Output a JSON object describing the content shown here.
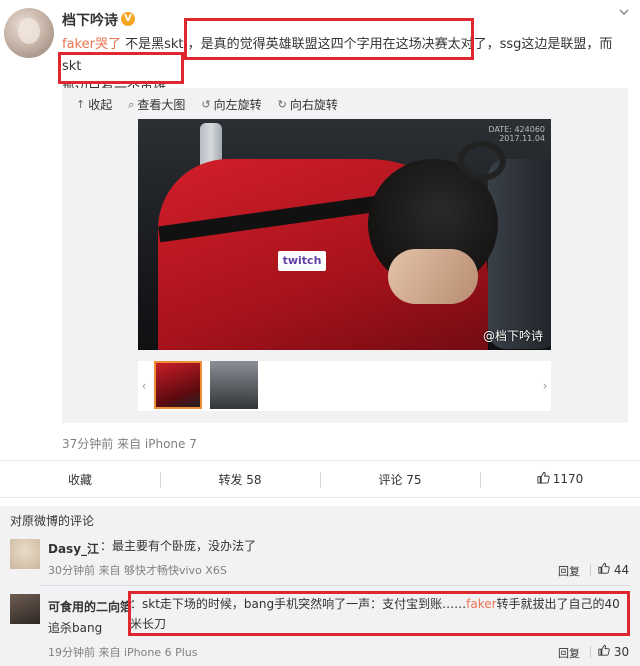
{
  "post": {
    "author": "档下吟诗",
    "verified_badge": "V",
    "menu_icon": "chevron-down-icon",
    "text": {
      "mention": "faker哭了",
      "line1_rest": " 不是黑skt ，是真的觉得英雄联盟这四个字用在这场决赛太对了，ssg这边是联盟，而skt",
      "line2": "那边只有一个英雄。"
    },
    "toolbar": {
      "collect": "收起",
      "view_large": "查看大图",
      "rotate_left": "向左旋转",
      "rotate_right": "向右旋转"
    },
    "photo": {
      "jersey_text": "twitch",
      "watermark": "@档下吟诗",
      "timestamp_line1": "DATE: 424060",
      "timestamp_line2": "2017.11.04"
    },
    "meta": "37分钟前 来自 iPhone 7"
  },
  "actions": {
    "favorite": "收藏",
    "repost": "转发 58",
    "comment": "评论 75",
    "like": "1170"
  },
  "comments": {
    "title": "对原微博的评论",
    "items": [
      {
        "name": "Dasy_江",
        "body": "：最主要有个卧庞，没办法了",
        "meta": "30分钟前 来自 够快才畅快vivo X6S",
        "reply": "回复",
        "likes": "44"
      },
      {
        "name": "可食用的二向箔",
        "body_before": "：skt走下场的时候，bang手机突然响了一声：支付宝到账……",
        "mention": "faker",
        "body_after": "转手就拔出了自己的40米长刀",
        "body_line2": "追杀bang",
        "meta": "19分钟前 来自 iPhone 6 Plus",
        "reply": "回复",
        "likes": "30"
      }
    ]
  },
  "colors": {
    "highlight": "#e0262e",
    "mention": "#eb7350",
    "badge": "#f5a623",
    "thumb_selected": "#f08b36"
  }
}
